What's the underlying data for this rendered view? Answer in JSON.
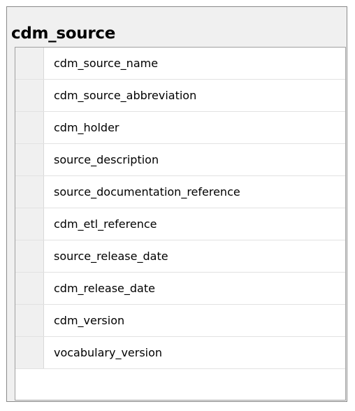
{
  "table": {
    "title": "cdm_source",
    "columns": [
      "cdm_source_name",
      "cdm_source_abbreviation",
      "cdm_holder",
      "source_description",
      "source_documentation_reference",
      "cdm_etl_reference",
      "source_release_date",
      "cdm_release_date",
      "cdm_version",
      "vocabulary_version"
    ]
  }
}
